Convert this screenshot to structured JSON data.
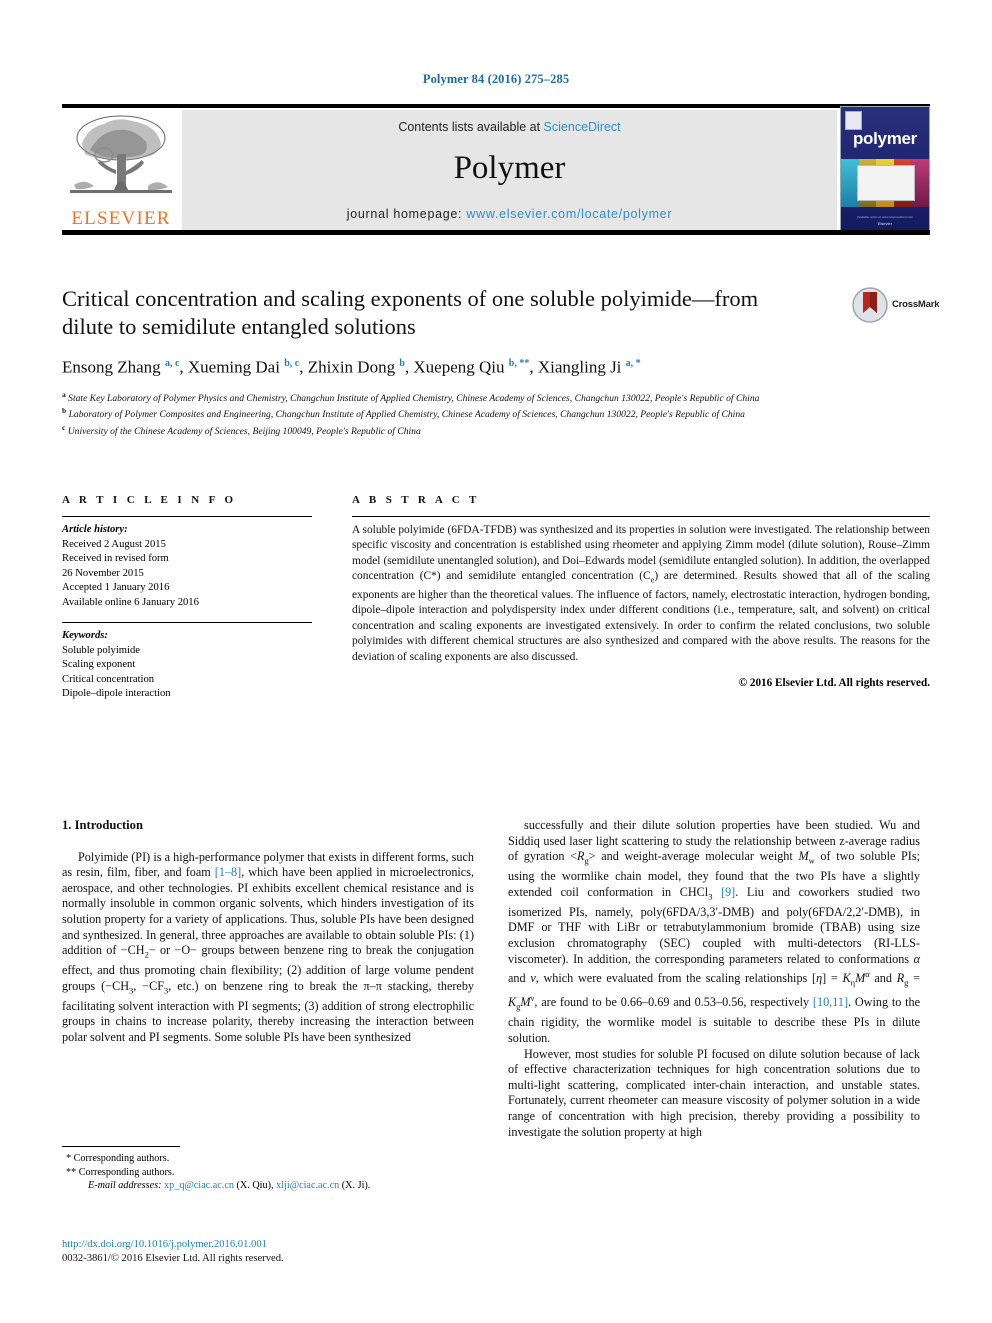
{
  "running_head": "Polymer 84 (2016) 275–285",
  "masthead": {
    "contents_prefix": "Contents lists available at ",
    "sciencedirect": "ScienceDirect",
    "journal_title": "Polymer",
    "homepage_prefix": "journal homepage: ",
    "homepage_url": "www.elsevier.com/locate/polymer",
    "publisher": "ELSEVIER",
    "cover_title": "polymer",
    "cover_footer": "Elsevier",
    "cover_subfooter": "Available online at www.sciencedirect.com"
  },
  "crossmark": {
    "label": "CrossMark"
  },
  "title": "Critical concentration and scaling exponents of one soluble polyimide—from dilute to semidilute entangled solutions",
  "authors": [
    {
      "name": "Ensong Zhang",
      "marks": "a, c",
      "sep": ", "
    },
    {
      "name": "Xueming Dai",
      "marks": "b, c",
      "sep": ", "
    },
    {
      "name": "Zhixin Dong",
      "marks": "b",
      "sep": ", "
    },
    {
      "name": "Xuepeng Qiu",
      "marks": "b, **",
      "sep": ", "
    },
    {
      "name": "Xiangling Ji",
      "marks": "a, *",
      "sep": ""
    }
  ],
  "affiliations": [
    {
      "mark": "a",
      "text": "State Key Laboratory of Polymer Physics and Chemistry, Changchun Institute of Applied Chemistry, Chinese Academy of Sciences, Changchun 130022, People's Republic of China"
    },
    {
      "mark": "b",
      "text": "Laboratory of Polymer Composites and Engineering, Changchun Institute of Applied Chemistry, Chinese Academy of Sciences, Changchun 130022, People's Republic of China"
    },
    {
      "mark": "c",
      "text": "University of the Chinese Academy of Sciences, Beijing 100049, People's Republic of China"
    }
  ],
  "article_info": {
    "heading": "A R T I C L E   I N F O",
    "history_label": "Article history:",
    "history": [
      "Received 2 August 2015",
      "Received in revised form",
      "26 November 2015",
      "Accepted 1 January 2016",
      "Available online 6 January 2016"
    ],
    "keywords_label": "Keywords:",
    "keywords": [
      "Soluble polyimide",
      "Scaling exponent",
      "Critical concentration",
      "Dipole–dipole interaction"
    ]
  },
  "abstract": {
    "heading": "A B S T R A C T",
    "body": "A soluble polyimide (6FDA-TFDB) was synthesized and its properties in solution were investigated. The relationship between specific viscosity and concentration is established using rheometer and applying Zimm model (dilute solution), Rouse–Zimm model (semidilute unentangled solution), and Doi–Edwards model (semidilute entangled solution). In addition, the overlapped concentration (C*) and semidilute entangled concentration (Ce) are determined. Results showed that all of the scaling exponents are higher than the theoretical values. The influence of factors, namely, electrostatic interaction, hydrogen bonding, dipole–dipole interaction and polydispersity index under different conditions (i.e., temperature, salt, and solvent) on critical concentration and scaling exponents are investigated extensively. In order to confirm the related conclusions, two soluble polyimides with different chemical structures are also synthesized and compared with the above results. The reasons for the deviation of scaling exponents are also discussed.",
    "copyright": "© 2016 Elsevier Ltd. All rights reserved."
  },
  "body": {
    "section_number_title": "1.  Introduction",
    "left_paragraph_1": "Polyimide (PI) is a high-performance polymer that exists in different forms, such as resin, film, fiber, and foam [1–8], which have been applied in microelectronics, aerospace, and other technologies. PI exhibits excellent chemical resistance and is normally insoluble in common organic solvents, which hinders investigation of its solution property for a variety of applications. Thus, soluble PIs have been designed and synthesized. In general, three approaches are available to obtain soluble PIs: (1) addition of −CH2− or −O− groups between benzene ring to break the conjugation effect, and thus promoting chain flexibility; (2) addition of large volume pendent groups (−CH3, −CF3, etc.) on benzene ring to break the π–π stacking, thereby facilitating solvent interaction with PI segments; (3) addition of strong electrophilic groups in chains to increase polarity, thereby increasing the interaction between polar solvent and PI segments. Some soluble PIs have been synthesized",
    "right_paragraph_1": "successfully and their dilute solution properties have been studied. Wu and Siddiq used laser light scattering to study the relationship between z-average radius of gyration <Rg> and weight-average molecular weight Mw of two soluble PIs; using the wormlike chain model, they found that the two PIs have a slightly extended coil conformation in CHCl3 [9]. Liu and coworkers studied two isomerized PIs, namely, poly(6FDA/3,3′-DMB) and poly(6FDA/2,2′-DMB), in DMF or THF with LiBr or tetrabutylammonium bromide (TBAB) using size exclusion chromatography (SEC) coupled with multi-detectors (RI-LLS-viscometer). In addition, the corresponding parameters related to conformations α and ν, which were evaluated from the scaling relationships [η] = KηMα and Rg = KgMν, are found to be 0.66–0.69 and 0.53–0.56, respectively [10,11]. Owing to the chain rigidity, the wormlike model is suitable to describe these PIs in dilute solution.",
    "right_paragraph_2": "However, most studies for soluble PI focused on dilute solution because of lack of effective characterization techniques for high concentration solutions due to multi-light scattering, complicated inter-chain interaction, and unstable states. Fortunately, current rheometer can measure viscosity of polymer solution in a wide range of concentration with high precision, thereby providing a possibility to investigate the solution property at high"
  },
  "footnotes": {
    "line1_mark": "*",
    "line1": "Corresponding authors.",
    "line2_mark": "**",
    "line2": "Corresponding authors.",
    "email_label": "E-mail addresses:",
    "email1": "xp_q@ciac.ac.cn",
    "email1_who": "(X. Qiu),",
    "email2": "xlji@ciac.ac.cn",
    "email2_who": "(X. Ji)."
  },
  "bottom": {
    "doi": "http://dx.doi.org/10.1016/j.polymer.2016.01.001",
    "issn": "0032-3861/© 2016 Elsevier Ltd. All rights reserved."
  },
  "colors": {
    "link_blue": "#1b7fbf",
    "sd_blue": "#2c8fc9",
    "elsevier_orange": "#E87722",
    "masthead_gray": "#e6e6e6",
    "cover_navy": "#232a78"
  }
}
